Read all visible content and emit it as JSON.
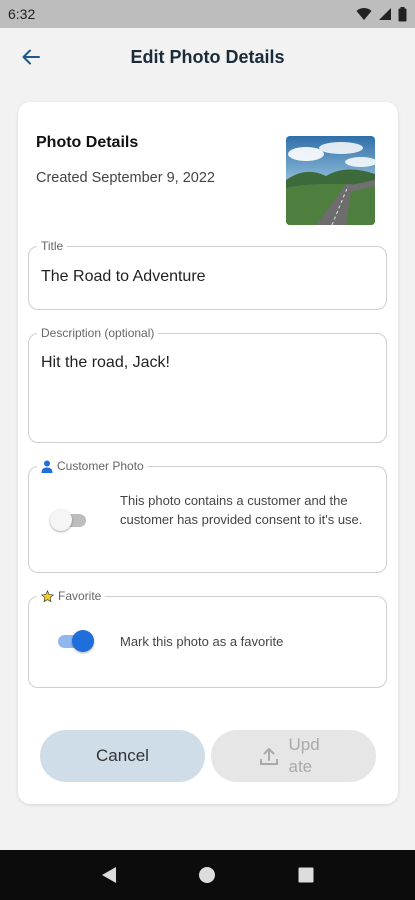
{
  "status_bar": {
    "time": "6:32"
  },
  "app_bar": {
    "title": "Edit Photo Details"
  },
  "card": {
    "heading": "Photo Details",
    "created": "Created September 9, 2022"
  },
  "title_field": {
    "label": "Title",
    "value": "The Road to Adventure"
  },
  "description_field": {
    "label": "Description (optional)",
    "value": "Hit the road, Jack!"
  },
  "customer_photo": {
    "label": "Customer Photo",
    "text": "This photo contains a customer and the customer has provided consent to it's use.",
    "enabled": false
  },
  "favorite": {
    "label": "Favorite",
    "text": "Mark this photo as a favorite",
    "enabled": true
  },
  "buttons": {
    "cancel": "Cancel",
    "update": "Update"
  },
  "colors": {
    "accent": "#1e6fdc",
    "cancel_bg": "#cfdde9",
    "title_text": "#1c2b3a",
    "star": "#f2d21b"
  }
}
